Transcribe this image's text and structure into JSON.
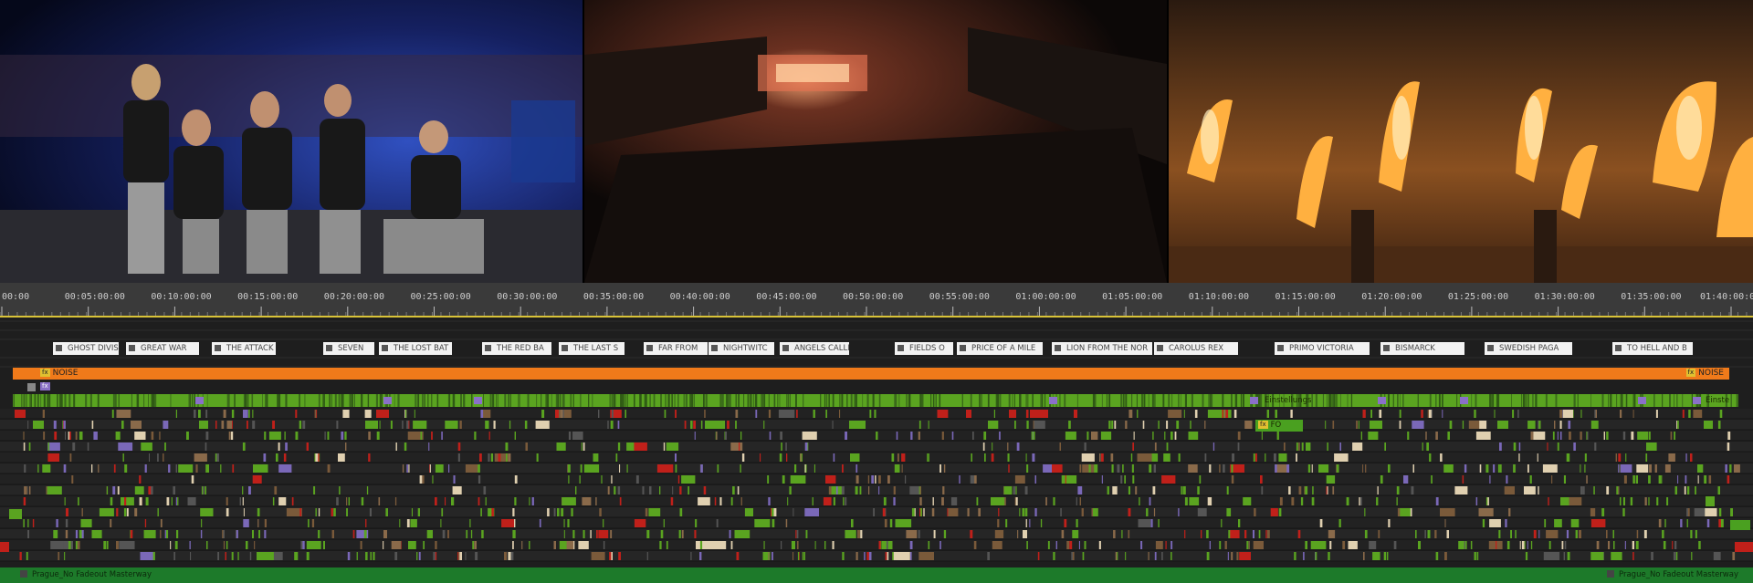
{
  "monitors": [
    {
      "name": "band-on-stage"
    },
    {
      "name": "arena-wide"
    },
    {
      "name": "stage-pyro"
    }
  ],
  "ruler": {
    "timecodes": [
      "00:00",
      "00:05:00:00",
      "00:10:00:00",
      "00:15:00:00",
      "00:20:00:00",
      "00:25:00:00",
      "00:30:00:00",
      "00:35:00:00",
      "00:40:00:00",
      "00:45:00:00",
      "00:50:00:00",
      "00:55:00:00",
      "01:00:00:00",
      "01:05:00:00",
      "01:10:00:00",
      "01:15:00:00",
      "01:20:00:00",
      "01:25:00:00",
      "01:30:00:00",
      "01:35:00:00",
      "01:40:00:00"
    ]
  },
  "song_markers": [
    {
      "label": "GHOST DIVIS"
    },
    {
      "label": "GREAT WAR"
    },
    {
      "label": "THE ATTACK"
    },
    {
      "label": "SEVEN"
    },
    {
      "label": "THE LOST BAT"
    },
    {
      "label": "THE RED BA"
    },
    {
      "label": "THE LAST S"
    },
    {
      "label": "FAR FROM"
    },
    {
      "label": "NIGHTWITC"
    },
    {
      "label": "ANGELS CALLING"
    },
    {
      "label": "FIELDS O"
    },
    {
      "label": "PRICE OF A MILE"
    },
    {
      "label": "LION FROM THE NOR"
    },
    {
      "label": "CAROLUS REX"
    },
    {
      "label": "PRIMO VICTORIA"
    },
    {
      "label": "BISMARCK"
    },
    {
      "label": "SWEDISH PAGA"
    },
    {
      "label": "TO HELL AND B"
    }
  ],
  "noise_track": {
    "label": "NOISE",
    "end_label": "NOISE",
    "fx": "fx"
  },
  "adjustment_track": {
    "label": "Einstellungs",
    "end_label": "Einste",
    "fx": "fx"
  },
  "fo_clip": {
    "label": "FO",
    "fx": "fx"
  },
  "audio_track": {
    "label": "Prague_No Fadeout Masterway",
    "end_label": "Prague_No Fadeout Masterway"
  },
  "colors": {
    "orange": "#f07a1a",
    "green": "#5aa420",
    "red": "#c0201a",
    "purple": "#8a70c8",
    "ruler": "#3a3a3a",
    "audio": "#1d7a2a"
  }
}
